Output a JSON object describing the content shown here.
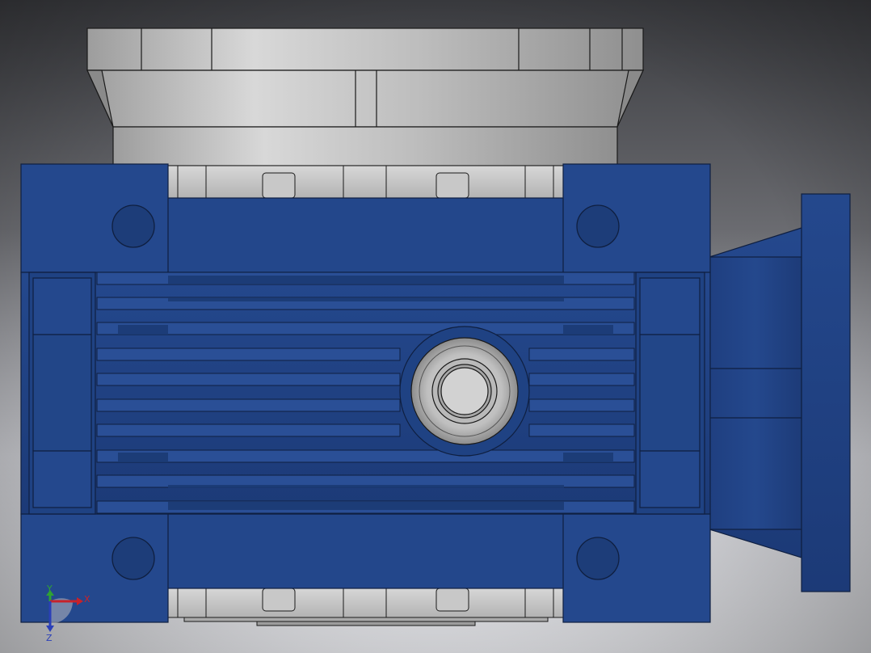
{
  "viewport": {
    "background_top": "#3b3c40",
    "background_bottom": "#e9eaef",
    "vignette": "#9a9ba1"
  },
  "model": {
    "housing_color": "#22468a",
    "housing_dark": "#1b3973",
    "housing_edge": "#0f1f40",
    "metal_light": "#d6d6d6",
    "metal_mid": "#a9a9a9",
    "metal_dark": "#7a7a7a"
  },
  "triad": {
    "x_label": "X",
    "y_label": "Y",
    "z_label": "Z",
    "x_color": "#c8222a",
    "y_color": "#2fa233",
    "z_color": "#2a3fb8"
  }
}
